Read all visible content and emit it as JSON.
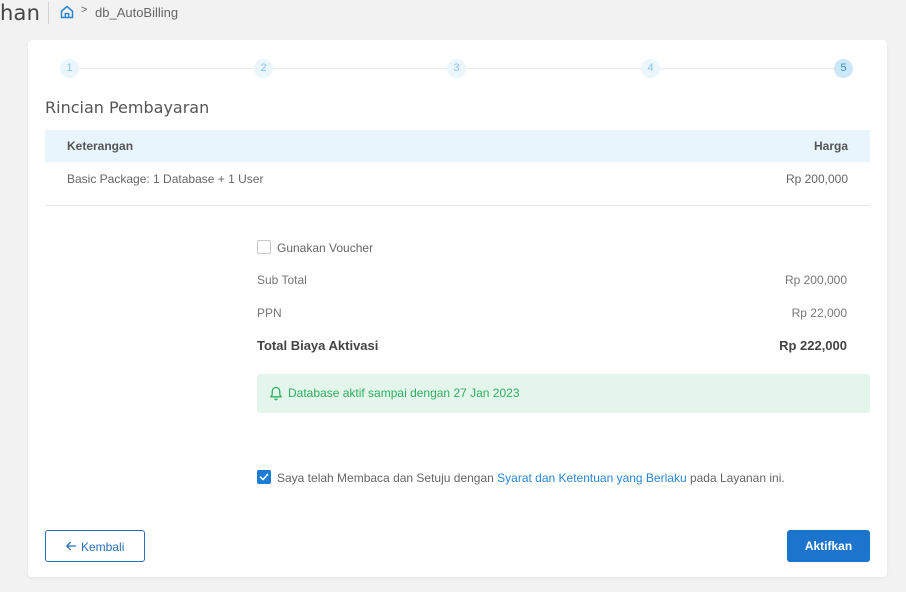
{
  "header": {
    "page_title_fragment": "han",
    "breadcrumb_current": "db_AutoBilling"
  },
  "stepper": {
    "steps": [
      "1",
      "2",
      "3",
      "4",
      "5"
    ],
    "active_step": 5
  },
  "section_title": "Rincian Pembayaran",
  "table": {
    "headers": [
      "Keterangan",
      "Harga"
    ],
    "rows": [
      {
        "description": "Basic Package: 1 Database + 1 User",
        "price": "Rp 200,000"
      }
    ]
  },
  "voucher": {
    "label": "Gunakan Voucher",
    "checked": false
  },
  "summary": {
    "subtotal_label": "Sub Total",
    "subtotal_value": "Rp 200,000",
    "ppn_label": "PPN",
    "ppn_value": "Rp 22,000",
    "total_label": "Total Biaya Aktivasi",
    "total_value": "Rp 222,000"
  },
  "alert": {
    "icon": "bell-icon",
    "text": "Database aktif sampai dengan 27 Jan 2023"
  },
  "agreement": {
    "checked": true,
    "prefix": "Saya telah Membaca dan Setuju dengan ",
    "link": "Syarat dan Ketentuan yang Berlaku",
    "suffix": " pada Layanan ini."
  },
  "buttons": {
    "back_label": "Kembali",
    "activate_label": "Aktifkan"
  },
  "colors": {
    "primary": "#1c74cc",
    "link": "#2a86d5",
    "success_text": "#2fae60",
    "success_bg": "#e4f6ec",
    "table_header_bg": "#e8f5fd"
  }
}
